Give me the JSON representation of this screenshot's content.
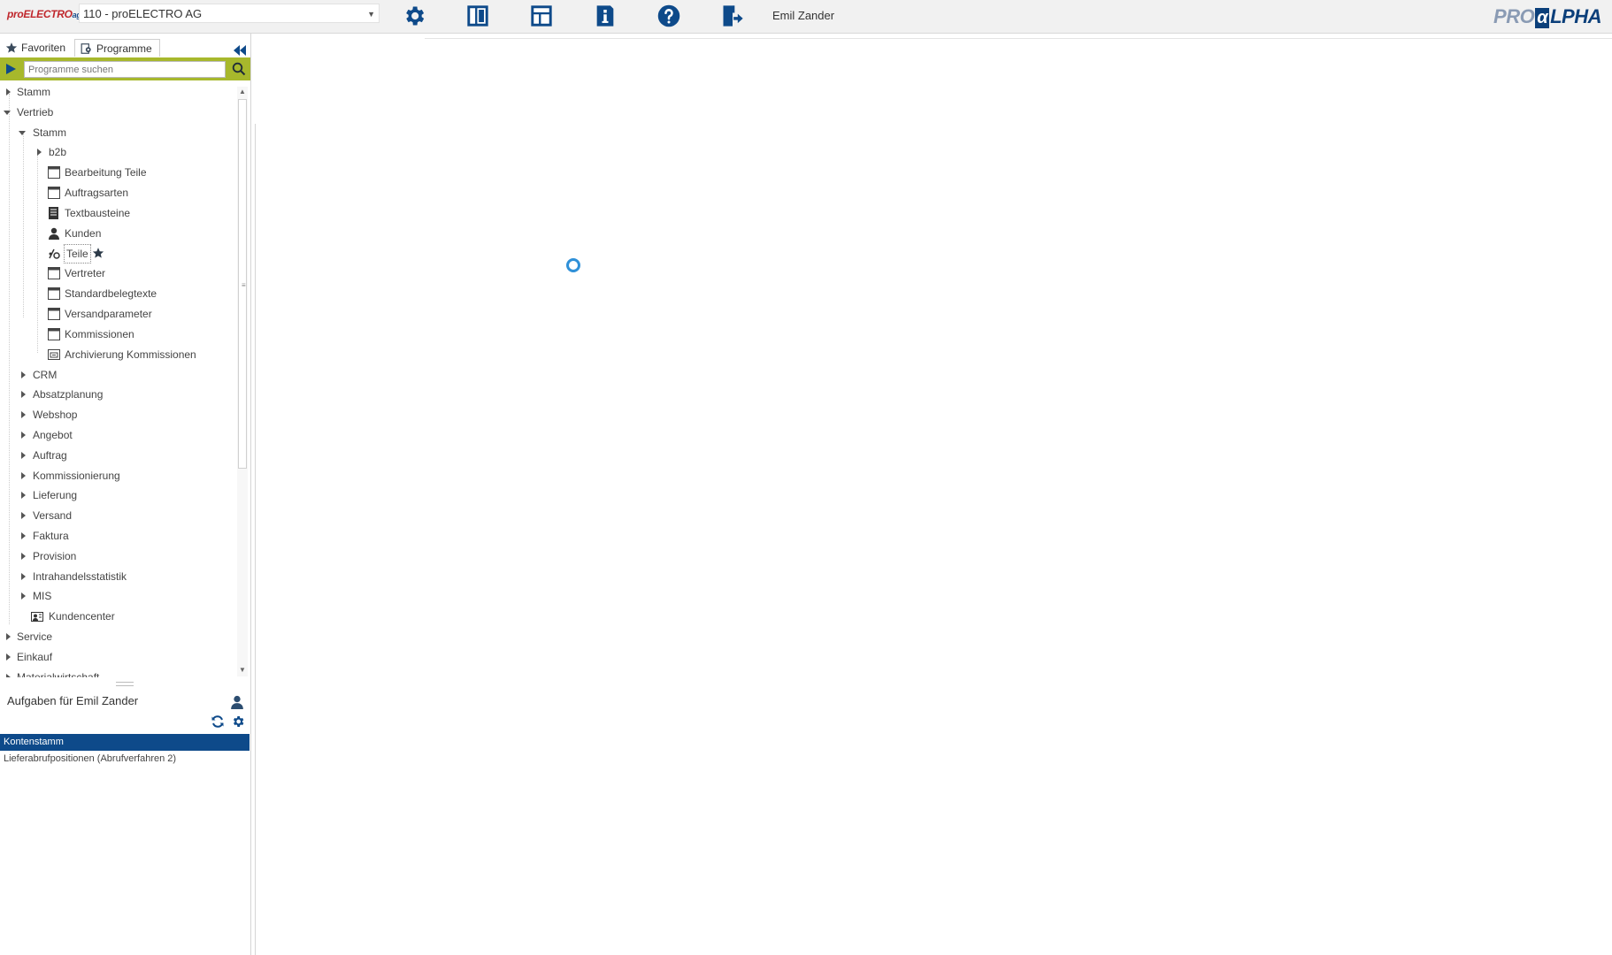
{
  "header": {
    "app_logo": "proELECTRO",
    "app_logo_suffix": "ag",
    "company": "110 - proELECTRO AG",
    "user_name": "Emil Zander",
    "brand_pre": "PRO",
    "brand_alpha": "α",
    "brand_post": "LPHA",
    "icons": [
      "gear-icon",
      "panel-icon",
      "layout-icon",
      "info-icon",
      "help-icon",
      "logout-icon"
    ]
  },
  "colors": {
    "accent": "#0e4a8a",
    "search_bar": "#a7b82c",
    "spinner": "#2f90d8"
  },
  "sidebar": {
    "tabs": [
      {
        "label": "Favoriten",
        "icon": "star-icon"
      },
      {
        "label": "Programme",
        "icon": "programs-icon"
      }
    ],
    "search": {
      "placeholder": "Programme suchen"
    },
    "tree": {
      "stamm": "Stamm",
      "vertrieb": "Vertrieb",
      "vertrieb_stamm": "Stamm",
      "b2b": "b2b",
      "bearbeitung_teile": "Bearbeitung Teile",
      "auftragsarten": "Auftragsarten",
      "textbausteine": "Textbausteine",
      "kunden": "Kunden",
      "teile": "Teile",
      "vertreter": "Vertreter",
      "standardbelegtexte": "Standardbelegtexte",
      "versandparameter": "Versandparameter",
      "kommissionen": "Kommissionen",
      "archivierung_kommissionen": "Archivierung Kommissionen",
      "crm": "CRM",
      "absatzplanung": "Absatzplanung",
      "webshop": "Webshop",
      "angebot": "Angebot",
      "auftrag": "Auftrag",
      "kommissionierung": "Kommissionierung",
      "lieferung": "Lieferung",
      "versand": "Versand",
      "faktura": "Faktura",
      "provision": "Provision",
      "intrahandelsstatistik": "Intrahandelsstatistik",
      "mis": "MIS",
      "kundencenter": "Kundencenter",
      "service": "Service",
      "einkauf": "Einkauf",
      "materialwirtschaft": "Materialwirtschaft"
    }
  },
  "tasks": {
    "title": "Aufgaben für Emil Zander",
    "items": [
      "Kontenstamm",
      "Lieferabrufpositionen (Abrufverfahren 2)"
    ]
  }
}
